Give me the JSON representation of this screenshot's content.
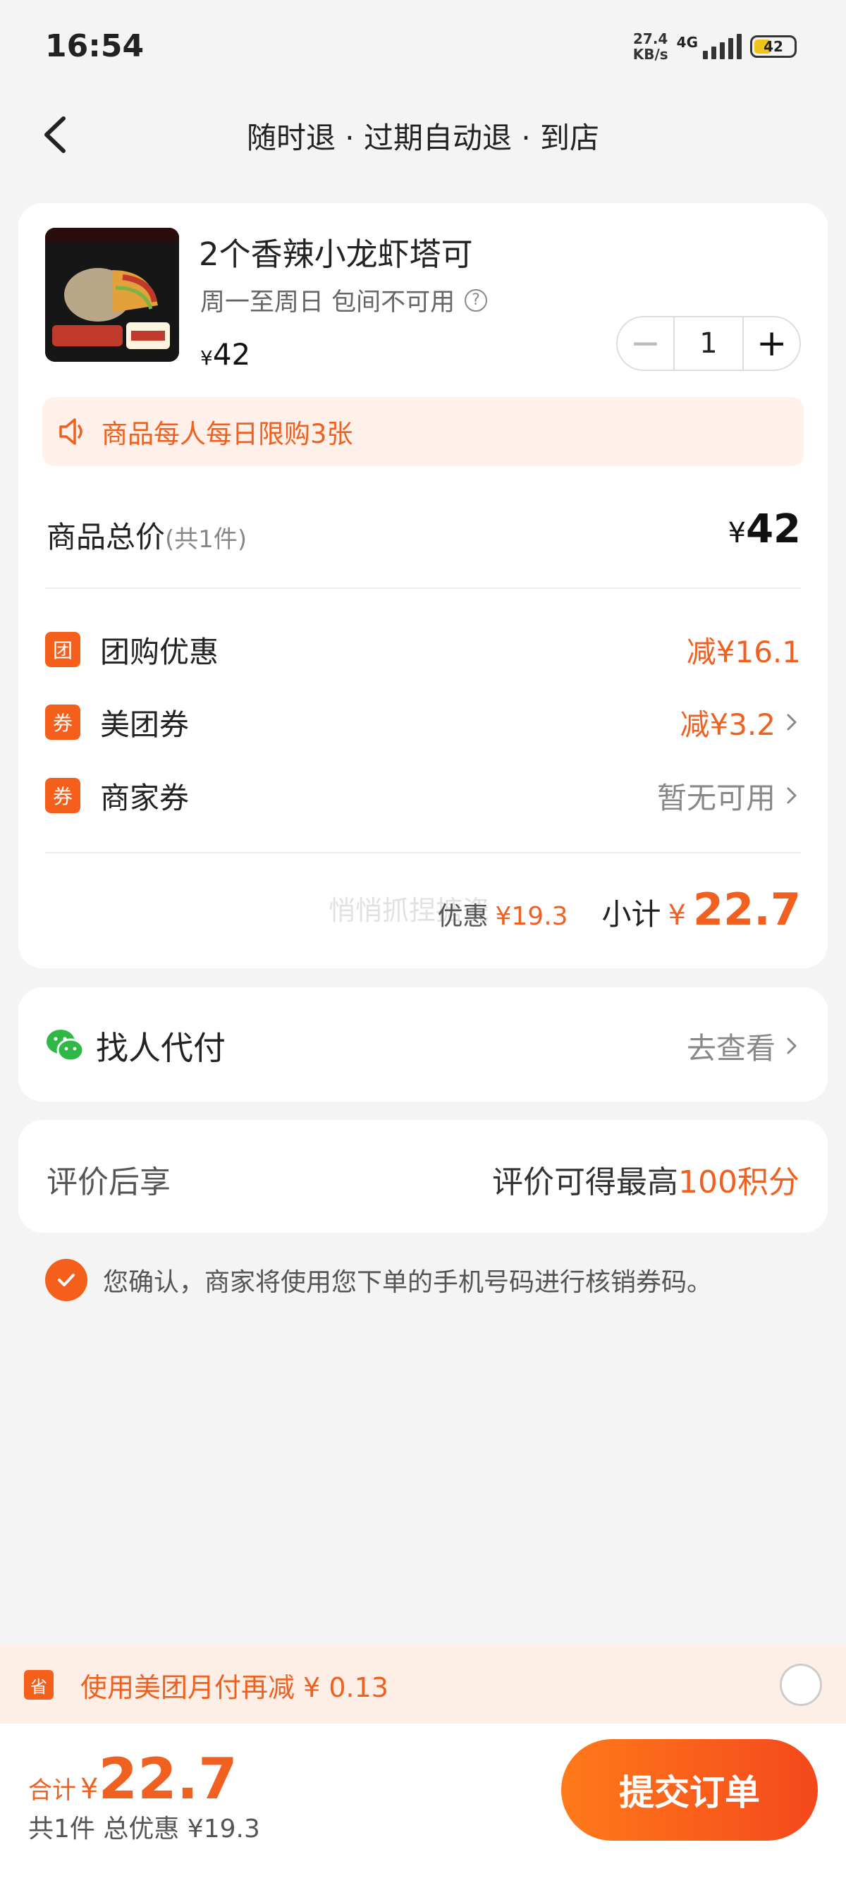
{
  "status_bar": {
    "time": "16:54",
    "net_speed_value": "27.4",
    "net_speed_unit": "KB/s",
    "network": "4G",
    "battery": "42"
  },
  "nav": {
    "title": "随时退 · 过期自动退 · 到店"
  },
  "product": {
    "name": "2个香辣小龙虾塔可",
    "subtitle": "周一至周日 包间不可用",
    "currency": "¥",
    "price": "42",
    "quantity": "1",
    "minus": "−",
    "plus": "+"
  },
  "limit_notice": "商品每人每日限购3张",
  "total": {
    "label": "商品总价",
    "count": "(共1件)",
    "currency": "¥",
    "value": "42"
  },
  "discounts": [
    {
      "badge": "团",
      "label": "团购优惠",
      "value": "减¥16.1",
      "muted": false,
      "arrow": false
    },
    {
      "badge": "券",
      "label": "美团券",
      "value": "减¥3.2",
      "muted": false,
      "arrow": true
    },
    {
      "badge": "券",
      "label": "商家券",
      "value": "暂无可用",
      "muted": true,
      "arrow": true
    }
  ],
  "subtotal": {
    "discount_label": "优惠",
    "discount_value": "¥19.3",
    "label": "小计",
    "currency": "¥",
    "value": "22.7",
    "watermark": "悄悄抓捏搪瓷"
  },
  "pay_for_me": {
    "label": "找人代付",
    "link": "去查看"
  },
  "review": {
    "label": "评价后享",
    "value_prefix": "评价可得最高",
    "value_highlight": "100积分"
  },
  "confirm_text": "您确认，商家将使用您下单的手机号码进行核销券码。",
  "promo": {
    "icon": "省",
    "text": "使用美团月付再减 ¥ 0.13"
  },
  "footer": {
    "sum_label": "合计",
    "currency": "¥",
    "sum_value": "22.7",
    "detail": "共1件  总优惠 ¥19.3",
    "submit": "提交订单"
  },
  "colors": {
    "accent": "#f4601c",
    "accent_text": "#f06020",
    "background": "#f4f4f4"
  }
}
